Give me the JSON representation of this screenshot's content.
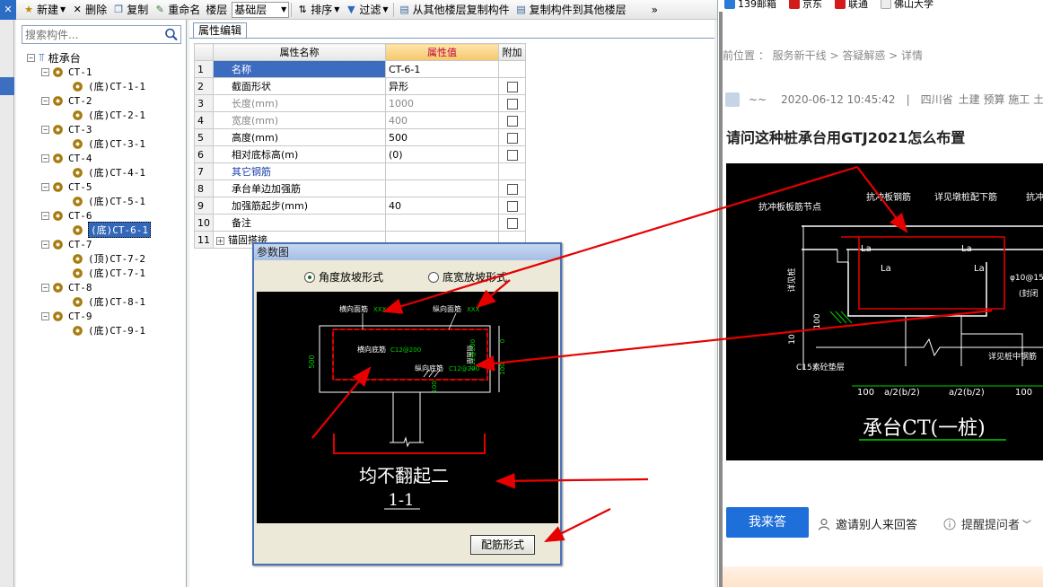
{
  "toolbar": {
    "new_label": "新建",
    "delete_label": "删除",
    "copy_label": "复制",
    "rename_label": "重命名",
    "floor_label": "楼层",
    "floor_value": "基础层",
    "sort_label": "排序",
    "filter_label": "过滤",
    "copy_from_label": "从其他楼层复制构件",
    "copy_to_label": "复制构件到其他楼层",
    "more_label": "»",
    "close_label": "✕"
  },
  "search": {
    "placeholder": "搜索构件..."
  },
  "tree": {
    "root": "桩承台",
    "groups": [
      {
        "name": "CT-1",
        "children": [
          "(底)CT-1-1"
        ]
      },
      {
        "name": "CT-2",
        "children": [
          "(底)CT-2-1"
        ]
      },
      {
        "name": "CT-3",
        "children": [
          "(底)CT-3-1"
        ]
      },
      {
        "name": "CT-4",
        "children": [
          "(底)CT-4-1"
        ]
      },
      {
        "name": "CT-5",
        "children": [
          "(底)CT-5-1"
        ]
      },
      {
        "name": "CT-6",
        "children": [
          "(底)CT-6-1"
        ]
      },
      {
        "name": "CT-7",
        "children": [
          "(顶)CT-7-2",
          "(底)CT-7-1"
        ]
      },
      {
        "name": "CT-8",
        "children": [
          "(底)CT-8-1"
        ]
      },
      {
        "name": "CT-9",
        "children": [
          "(底)CT-9-1"
        ]
      }
    ],
    "selected": "(底)CT-6-1"
  },
  "props": {
    "tab": "属性编辑",
    "headers": {
      "name": "属性名称",
      "value": "属性值",
      "extra": "附加"
    },
    "rows": [
      {
        "num": "1",
        "name": "名称",
        "value": "CT-6-1"
      },
      {
        "num": "2",
        "name": "截面形状",
        "value": "异形"
      },
      {
        "num": "3",
        "name": "长度(mm)",
        "value": "1000"
      },
      {
        "num": "4",
        "name": "宽度(mm)",
        "value": "400"
      },
      {
        "num": "5",
        "name": "高度(mm)",
        "value": "500"
      },
      {
        "num": "6",
        "name": "相对底标高(m)",
        "value": "(0)"
      },
      {
        "num": "7",
        "name": "其它钢筋",
        "value": ""
      },
      {
        "num": "8",
        "name": "承台单边加强筋",
        "value": ""
      },
      {
        "num": "9",
        "name": "加强筋起步(mm)",
        "value": "40"
      },
      {
        "num": "10",
        "name": "备注",
        "value": ""
      },
      {
        "num": "11",
        "name": "锚固搭接",
        "value": ""
      }
    ]
  },
  "dialog": {
    "title": "参数图",
    "radio1": "角度放坡形式",
    "radio2": "底宽放坡形式",
    "diagram": {
      "top_bar_h": "横向面筋",
      "top_bar_v": "纵向面筋",
      "top_val": "XXX",
      "bottom_bar_h": "横向底筋",
      "bottom_bar_h_val": "C12@200",
      "bottom_bar_v": "纵向底筋",
      "bottom_bar_v_val": "C12@200",
      "side_bar": "侧面筋",
      "side_val": "C12@200",
      "height": "500",
      "dim_0": "0",
      "dim_100a": "100",
      "dim_100b": "100",
      "caption": "均不翻起二",
      "section": "1-1"
    },
    "button": "配筋形式"
  },
  "web": {
    "bookmarks": [
      "139邮箱",
      "京东",
      "联通",
      "佛山大学"
    ],
    "crumbs": "前位置 ： 服务新干线 > 答疑解惑 > 详情",
    "meta": {
      "user": "~~",
      "date": "2020-06-12 10:45:42",
      "sep": "|",
      "region": "四川省",
      "tags": "土建 预算 施工 土"
    },
    "title": "请问这种桩承台用GTJ2021怎么布置",
    "cad": {
      "l1": "抗冲板板筋节点",
      "l2": "抗冲板钢筋",
      "l3": "详见墩桩配下筋",
      "l4": "抗冲",
      "la": "La",
      "stirrup": "φ10@15",
      "note": "(封闭",
      "vert": "详见桩",
      "d100": "100",
      "d10": "10",
      "cushion": "C15素砼垫层",
      "pile": "详见桩中钢筋",
      "bot1": "100",
      "bot2": "a/2(b/2)",
      "bot3": "a/2(b/2)",
      "bot4": "100",
      "caption": "承台CT(一桩)"
    },
    "answer": "我来答",
    "invite": "邀请别人来回答",
    "remind": "提醒提问者"
  },
  "colors": {
    "red": "#e00000",
    "green": "#00d000",
    "selected": "#3367b8",
    "answer_blue": "#1e6fd9"
  }
}
